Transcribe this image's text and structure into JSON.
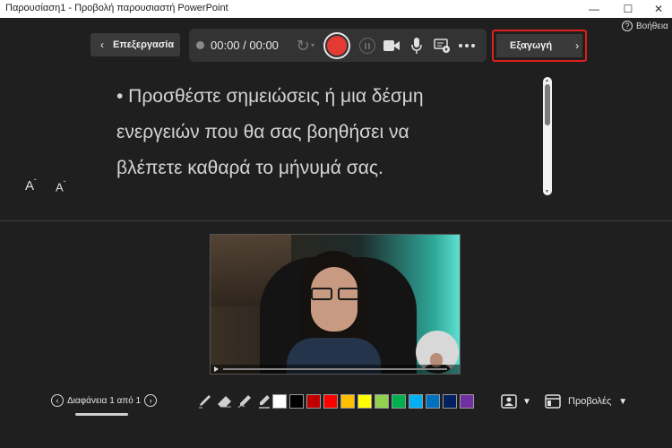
{
  "window": {
    "title": "Παρουσίαση1 - Προβολή παρουσιαστή PowerPoint",
    "minimize": "—",
    "maximize": "☐",
    "close": "✕"
  },
  "help": {
    "icon_glyph": "?",
    "label": "Βοήθεια"
  },
  "edit_button": {
    "chevron": "‹",
    "label": "Επεξεργασία"
  },
  "recording": {
    "time": "00:00 / 00:00",
    "replay_glyph": "↻",
    "replay_caret": "▾",
    "record_color": "#e33b33"
  },
  "export_button": {
    "label": "Εξαγωγή",
    "chevron": "›",
    "highlight_color": "#e0201c"
  },
  "notes": {
    "lines": [
      "• Προσθέστε σημειώσεις ή μια δέσμη",
      "ενεργειών που θα σας βοηθήσει να",
      "βλέπετε καθαρά το μήνυμά σας."
    ],
    "cut_line": ". .. . . . .. . .. ..."
  },
  "font_controls": {
    "increase": "A",
    "increase_sup": "ˆ",
    "decrease": "A",
    "decrease_sup": "ˇ"
  },
  "slide_nav": {
    "prev": "‹",
    "label": "Διαφάνεια 1 από 1",
    "next": "›"
  },
  "ink_tools": [
    "pen-icon",
    "eraser-icon",
    "highlighter-icon",
    "marker-icon"
  ],
  "colors": [
    "#ffffff",
    "#000000",
    "#c00000",
    "#ff0000",
    "#ffc000",
    "#ffff00",
    "#92d050",
    "#00b050",
    "#00b0f0",
    "#0070c0",
    "#002060",
    "#7030a0"
  ],
  "camera_toggle": {
    "caret": "▼"
  },
  "views": {
    "label": "Προβολές",
    "caret": "▼"
  }
}
